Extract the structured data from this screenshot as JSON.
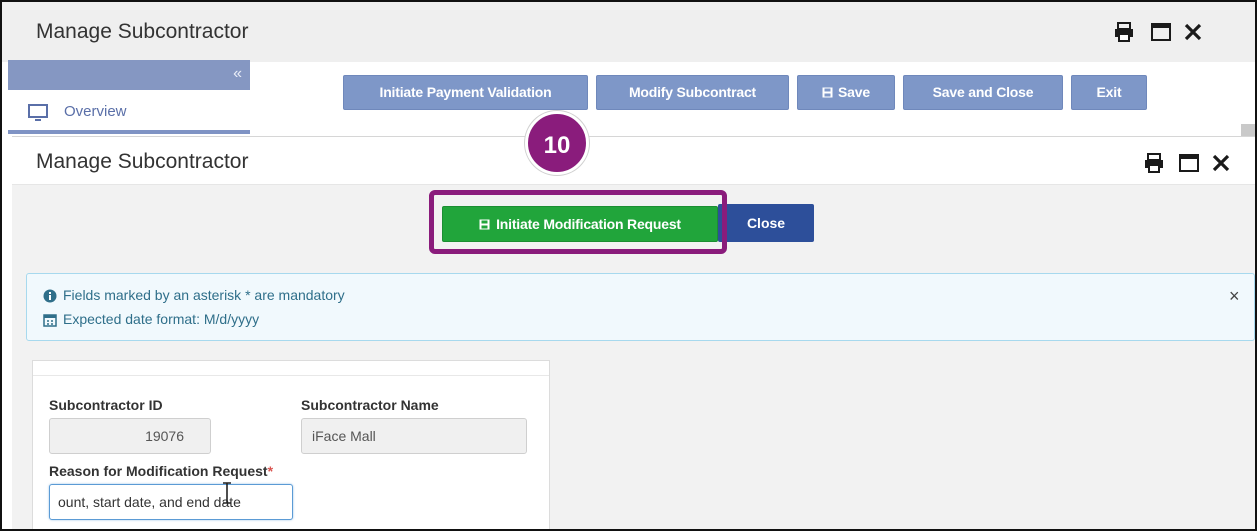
{
  "background_window": {
    "title": "Manage Subcontractor",
    "sidebar": {
      "collapse_glyph": "«",
      "overview_label": "Overview"
    },
    "toolbar": {
      "initiate_payment_validation": "Initiate Payment Validation",
      "modify_subcontract": "Modify Subcontract",
      "save": "Save",
      "save_and_close": "Save and Close",
      "exit": "Exit"
    }
  },
  "modal": {
    "title": "Manage Subcontractor",
    "buttons": {
      "initiate_modification_request": "Initiate Modification Request",
      "close": "Close"
    },
    "info": {
      "line1": "Fields marked by an asterisk * are mandatory",
      "line2": "Expected date format: M/d/yyyy",
      "dismiss_glyph": "×"
    },
    "form": {
      "subcontractor_id_label": "Subcontractor ID",
      "subcontractor_id_value": "19076",
      "subcontractor_name_label": "Subcontractor Name",
      "subcontractor_name_value": "iFace Mall",
      "reason_label": "Reason for Modification Request",
      "required_marker": "*",
      "reason_value": "ount, start date, and end date"
    }
  },
  "callout": {
    "step_number": "10",
    "color": "#8a1c7c"
  },
  "colors": {
    "toolbar_button": "#7e97c8",
    "primary_green": "#21a53b",
    "close_button": "#2d4f9a",
    "info_text": "#2f6f8a"
  }
}
